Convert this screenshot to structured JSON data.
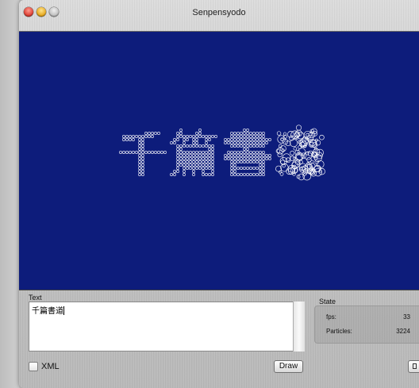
{
  "window": {
    "title": "Senpensyodo"
  },
  "canvas": {
    "background": "#0d1c7b",
    "glyph_color": "#ffffff",
    "rendered_text": "千篇書道"
  },
  "text_panel": {
    "label": "Text",
    "value": "千篇書道"
  },
  "xml_option": {
    "label": "XML",
    "checked": false
  },
  "draw_button": {
    "label": "Draw"
  },
  "state_panel": {
    "label": "State",
    "fps_label": "fps:",
    "fps_value": "33",
    "particles_label": "Particles:",
    "particles_value": "3224"
  }
}
